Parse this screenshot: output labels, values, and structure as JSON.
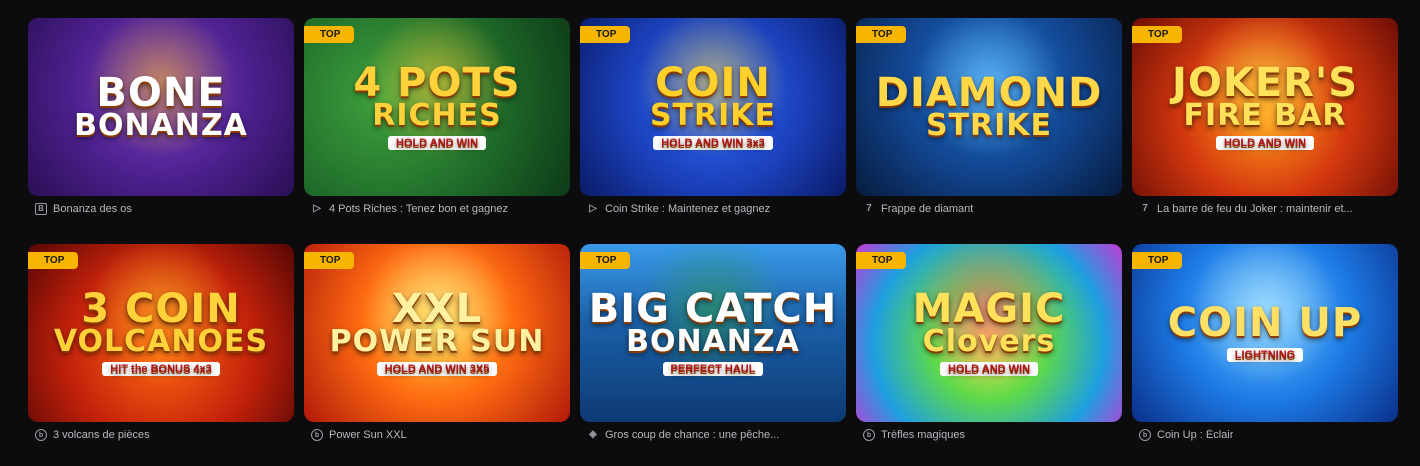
{
  "badge_label": "TOP",
  "games": [
    {
      "title": "Bonanza des os",
      "provider_icon": "b-box-icon",
      "provider_glyph": "B",
      "top": false,
      "theme": "t-bone",
      "art": {
        "line1": "BONE",
        "line2": "BONANZA",
        "sub": "",
        "color": "#ffffff"
      }
    },
    {
      "title": "4 Pots Riches : Tenez bon et gagnez",
      "provider_icon": "play-flag-icon",
      "provider_glyph": "▷",
      "top": true,
      "theme": "t-pots",
      "art": {
        "line1": "4 POTS",
        "line2": "RICHES",
        "sub": "HOLD AND WIN",
        "color": "#ffd23c"
      }
    },
    {
      "title": "Coin Strike : Maintenez et gagnez",
      "provider_icon": "play-flag-icon",
      "provider_glyph": "▷",
      "top": true,
      "theme": "t-coin",
      "art": {
        "line1": "COIN",
        "line2": "STRIKE",
        "sub": "HOLD AND WIN 3x3",
        "color": "#ffcf2a"
      }
    },
    {
      "title": "Frappe de diamant",
      "provider_icon": "seven-icon",
      "provider_glyph": "7",
      "top": true,
      "theme": "t-diam",
      "art": {
        "line1": "DIAMOND",
        "line2": "STRIKE",
        "sub": "",
        "color": "#ffd84a"
      }
    },
    {
      "title": "La barre de feu du Joker : maintenir et...",
      "provider_icon": "seven-icon",
      "provider_glyph": "7",
      "top": true,
      "theme": "t-joker",
      "art": {
        "line1": "JOKER'S",
        "line2": "FIRE BAR",
        "sub": "HOLD AND WIN",
        "color": "#ffe15a"
      }
    },
    {
      "title": "3 volcans de pièces",
      "provider_icon": "d-circle-icon",
      "provider_glyph": "b",
      "top": true,
      "theme": "t-volc",
      "art": {
        "line1": "3 COIN",
        "line2": "VOLCANOES",
        "sub": "HIT the BONUS 4x3",
        "color": "#ffd23a"
      }
    },
    {
      "title": "Power Sun XXL",
      "provider_icon": "d-circle-icon",
      "provider_glyph": "b",
      "top": true,
      "theme": "t-sun",
      "art": {
        "line1": "XXL",
        "line2": "POWER SUN",
        "sub": "HOLD AND WIN 3X5",
        "color": "#fff1a0"
      }
    },
    {
      "title": "Gros coup de chance : une pêche...",
      "provider_icon": "diamond-grid-icon",
      "provider_glyph": "◈",
      "top": true,
      "theme": "t-catch",
      "art": {
        "line1": "BIG CATCH",
        "line2": "BONANZA",
        "sub": "PERFECT HAUL",
        "color": "#ffffff"
      }
    },
    {
      "title": "Trèfles magiques",
      "provider_icon": "d-circle-icon",
      "provider_glyph": "b",
      "top": true,
      "theme": "t-clover",
      "art": {
        "line1": "MAGIC",
        "line2": "Clovers",
        "sub": "HOLD AND WIN",
        "color": "#ffe15a"
      }
    },
    {
      "title": "Coin Up : Éclair",
      "provider_icon": "d-circle-icon",
      "provider_glyph": "b",
      "top": true,
      "theme": "t-coinup",
      "art": {
        "line1": "COIN UP",
        "line2": "",
        "sub": "LIGHTNING",
        "color": "#ffe066"
      }
    }
  ]
}
